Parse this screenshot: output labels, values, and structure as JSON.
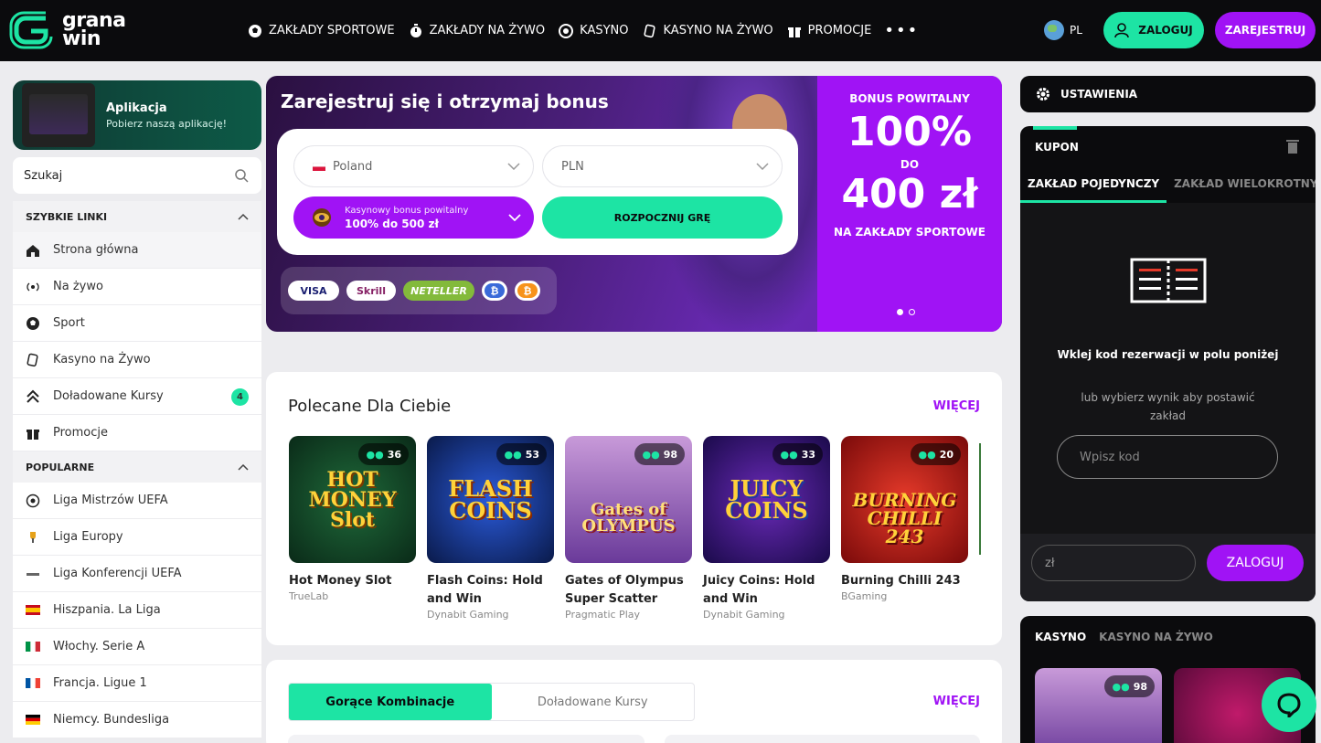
{
  "header": {
    "logo_line1": "grana",
    "logo_line2": "win",
    "nav": [
      {
        "label": "ZAKŁADY SPORTOWE",
        "icon": "soccer-ball-icon"
      },
      {
        "label": "ZAKŁADY NA ŻYWO",
        "icon": "stopwatch-icon"
      },
      {
        "label": "KASYNO",
        "icon": "casino-chip-icon"
      },
      {
        "label": "KASYNO NA ŻYWO",
        "icon": "cards-icon"
      },
      {
        "label": "PROMOCJE",
        "icon": "gift-icon"
      }
    ],
    "more": "•••",
    "lang": "PL",
    "login": "ZALOGUJ",
    "register": "ZAREJESTRUJ"
  },
  "sidebar": {
    "app_title": "Aplikacja",
    "app_sub": "Pobierz naszą aplikację!",
    "search_placeholder": "Szukaj",
    "quick_links_title": "SZYBKIE LINKI",
    "quick_links": [
      {
        "label": "Strona główna",
        "icon": "home-icon"
      },
      {
        "label": "Na żywo",
        "icon": "live-signal-icon"
      },
      {
        "label": "Sport",
        "icon": "soccer-ball-icon"
      },
      {
        "label": "Kasyno na Żywo",
        "icon": "cards-icon"
      },
      {
        "label": "Doładowane Kursy",
        "icon": "double-chevron-up-icon",
        "badge": "4"
      },
      {
        "label": "Promocje",
        "icon": "gift-icon"
      }
    ],
    "popular_title": "POPULARNE",
    "popular": [
      {
        "label": "Liga Mistrzów UEFA",
        "icon": "champions-league-icon"
      },
      {
        "label": "Liga Europy",
        "icon": "europa-league-icon"
      },
      {
        "label": "Liga Konferencji UEFA",
        "icon": "conference-league-icon"
      },
      {
        "label": "Hiszpania. La Liga",
        "icon": "spain-flag-icon"
      },
      {
        "label": "Włochy. Serie A",
        "icon": "italy-flag-icon"
      },
      {
        "label": "Francja. Ligue 1",
        "icon": "france-flag-icon"
      },
      {
        "label": "Niemcy. Bundesliga",
        "icon": "germany-flag-icon"
      }
    ]
  },
  "hero": {
    "title": "Zarejestruj się i otrzymaj bonus",
    "country": "Poland",
    "currency": "PLN",
    "bonus_line1": "Kasynowy bonus powitalny",
    "bonus_line2": "100% do 500 zł",
    "play": "ROZPOCZNIJ GRĘ",
    "payments": [
      "VISA",
      "Skrill",
      "NETELLER",
      "₿",
      "₿"
    ],
    "bonus_label": "BONUS POWITALNY",
    "bonus_percent": "100%",
    "bonus_do": "DO",
    "bonus_amount": "400 zł",
    "bonus_target": "NA ZAKŁADY SPORTOWE"
  },
  "recommended": {
    "title": "Polecane Dla Ciebie",
    "more": "WIĘCEJ",
    "games": [
      {
        "name": "Hot Money Slot",
        "provider": "TrueLab",
        "players": "36",
        "art": "HOT MONEY Slot",
        "color": "#0e3a2a"
      },
      {
        "name": "Flash Coins: Hold and Win",
        "provider": "Dynabit Gaming",
        "players": "53",
        "art": "FLASH COINS",
        "color": "#12307a"
      },
      {
        "name": "Gates of Olympus Super Scatter",
        "provider": "Pragmatic Play",
        "players": "98",
        "art": "Gates of OLYMPUS",
        "color": "#7a4fa0"
      },
      {
        "name": "Juicy Coins: Hold and Win",
        "provider": "Dynabit Gaming",
        "players": "33",
        "art": "JUICY COINS",
        "color": "#3a1a7a"
      },
      {
        "name": "Burning Chilli 243",
        "provider": "BGaming",
        "players": "20",
        "art": "BURNING CHILLI 243",
        "color": "#b0141a"
      }
    ]
  },
  "combos": {
    "tab_active": "Gorące Kombinacje",
    "tab_other": "Doładowane Kursy",
    "more": "WIĘCEJ"
  },
  "right": {
    "settings": "USTAWIENIA",
    "coupon": "KUPON",
    "tab_single": "ZAKŁAD POJEDYNCZY",
    "tab_multi": "ZAKŁAD WIELOKROTNY",
    "msg": "Wklej kod rezerwacji w polu poniżej",
    "sub": "lub wybierz wynik aby postawić zakład",
    "code_placeholder": "Wpisz kod",
    "amount_placeholder": "zł",
    "login": "ZALOGUJ",
    "casino_tab": "KASYNO",
    "live_casino_tab": "KASYNO NA ŻYWO",
    "casino_game_players": "98"
  },
  "colors": {
    "accent_green": "#1de4a4",
    "accent_purple": "#a013f5",
    "dark": "#0b0b0d"
  }
}
